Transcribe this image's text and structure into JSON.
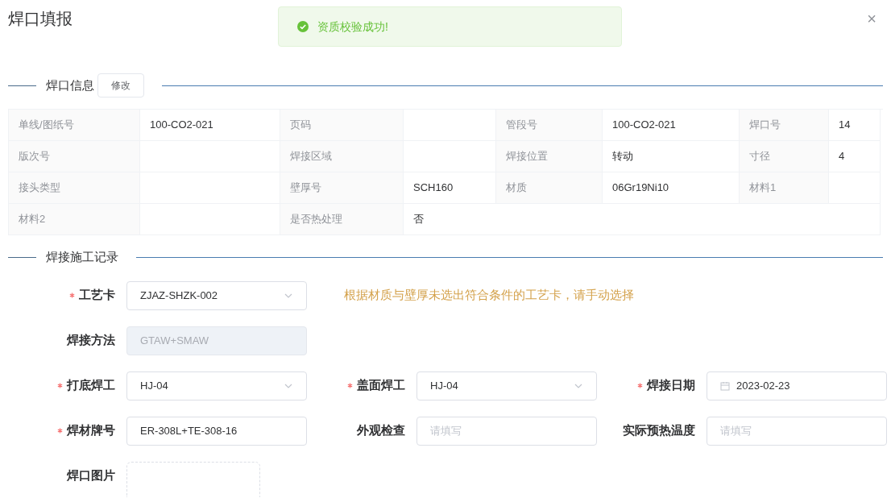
{
  "dialog": {
    "title": "焊口填报",
    "close": "×"
  },
  "toast": {
    "message": "资质校验成功!"
  },
  "info_section": {
    "title": "焊口信息",
    "edit_button": "修改"
  },
  "info_table": {
    "rows": [
      {
        "cells": [
          {
            "kind": "label",
            "text": "单线/图纸号"
          },
          {
            "kind": "value",
            "text": "100-CO2-021"
          },
          {
            "kind": "label",
            "text": "页码"
          },
          {
            "kind": "value",
            "text": ""
          },
          {
            "kind": "label",
            "text": "管段号"
          },
          {
            "kind": "value",
            "text": "100-CO2-021"
          },
          {
            "kind": "label",
            "text": "焊口号"
          },
          {
            "kind": "value",
            "text": "14"
          }
        ]
      },
      {
        "cells": [
          {
            "kind": "label",
            "text": "版次号"
          },
          {
            "kind": "value",
            "text": ""
          },
          {
            "kind": "label",
            "text": "焊接区域"
          },
          {
            "kind": "value",
            "text": ""
          },
          {
            "kind": "label",
            "text": "焊接位置"
          },
          {
            "kind": "value",
            "text": "转动"
          },
          {
            "kind": "label",
            "text": "寸径"
          },
          {
            "kind": "value",
            "text": "4"
          }
        ]
      },
      {
        "cells": [
          {
            "kind": "label",
            "text": "接头类型"
          },
          {
            "kind": "value",
            "text": ""
          },
          {
            "kind": "label",
            "text": "壁厚号"
          },
          {
            "kind": "value",
            "text": "SCH160"
          },
          {
            "kind": "label",
            "text": "材质"
          },
          {
            "kind": "value",
            "text": "06Gr19Ni10"
          },
          {
            "kind": "label",
            "text": "材料1"
          },
          {
            "kind": "value",
            "text": ""
          }
        ]
      },
      {
        "cells": [
          {
            "kind": "label",
            "text": "材料2"
          },
          {
            "kind": "value",
            "text": ""
          },
          {
            "kind": "label",
            "text": "是否热处理"
          },
          {
            "kind": "value",
            "text": "否"
          }
        ]
      }
    ]
  },
  "record_section": {
    "title": "焊接施工记录"
  },
  "form": {
    "rows": [
      {
        "fields": [
          {
            "label": "工艺卡",
            "required": true,
            "kind": "select",
            "value": "ZJAZ-SHZK-002",
            "disabled": false
          }
        ],
        "hint": "根据材质与壁厚未选出符合条件的工艺卡，请手动选择"
      },
      {
        "fields": [
          {
            "label": "焊接方法",
            "required": false,
            "kind": "input",
            "value": "GTAW+SMAW",
            "disabled": true
          }
        ]
      },
      {
        "fields": [
          {
            "label": "打底焊工",
            "required": true,
            "kind": "select",
            "value": "HJ-04",
            "disabled": false
          },
          {
            "label": "盖面焊工",
            "required": true,
            "kind": "select",
            "value": "HJ-04",
            "disabled": false
          },
          {
            "label": "焊接日期",
            "required": true,
            "kind": "date",
            "value": "2023-02-23",
            "disabled": false
          }
        ]
      },
      {
        "fields": [
          {
            "label": "焊材牌号",
            "required": true,
            "kind": "input",
            "value": "ER-308L+TE-308-16",
            "disabled": false
          },
          {
            "label": "外观检查",
            "required": false,
            "kind": "input",
            "placeholder": "请填写",
            "disabled": false
          },
          {
            "label": "实际预热温度",
            "required": false,
            "kind": "input",
            "placeholder": "请填写",
            "disabled": false
          }
        ]
      },
      {
        "fields": [
          {
            "label": "焊口图片",
            "required": false,
            "kind": "upload",
            "disabled": false
          }
        ]
      }
    ]
  }
}
